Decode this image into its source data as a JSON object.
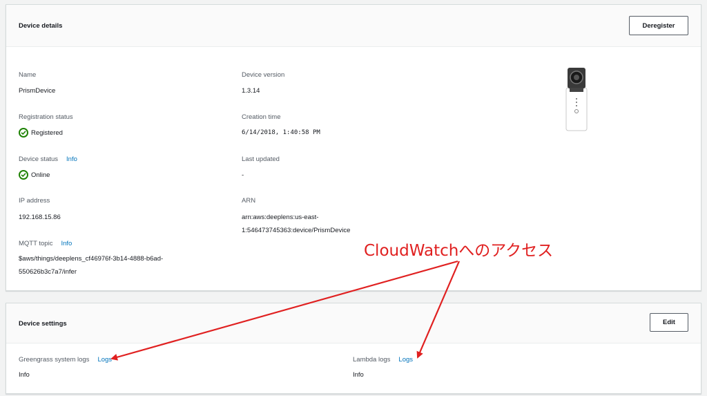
{
  "device_details": {
    "title": "Device details",
    "deregister_label": "Deregister",
    "name_label": "Name",
    "name_value": "PrismDevice",
    "registration_label": "Registration status",
    "registration_value": "Registered",
    "device_status_label": "Device status",
    "device_status_info": "Info",
    "device_status_value": "Online",
    "ip_label": "IP address",
    "ip_value": "192.168.15.86",
    "mqtt_label": "MQTT topic",
    "mqtt_info": "Info",
    "mqtt_value_line1": "$aws/things/deeplens_cf46976f-3b14-4888-b6ad-",
    "mqtt_value_line2": "550626b3c7a7/infer",
    "version_label": "Device version",
    "version_value": "1.3.14",
    "creation_label": "Creation time",
    "creation_value": "6/14/2018, 1:40:58 PM",
    "updated_label": "Last updated",
    "updated_value": "-",
    "arn_label": "ARN",
    "arn_value_line1": "arn:aws:deeplens:us-east-",
    "arn_value_line2": "1:546473745363:device/PrismDevice",
    "device_image_icon": "deeplens-camera-icon"
  },
  "device_settings": {
    "title": "Device settings",
    "edit_label": "Edit",
    "greengrass_label": "Greengrass system logs",
    "greengrass_link": "Logs",
    "greengrass_value": "Info",
    "lambda_label": "Lambda logs",
    "lambda_link": "Logs",
    "lambda_value": "Info"
  },
  "annotation": {
    "text": "CloudWatchへのアクセス",
    "color": "#e02020"
  },
  "colors": {
    "link": "#0073bb",
    "success": "#1d8102"
  }
}
